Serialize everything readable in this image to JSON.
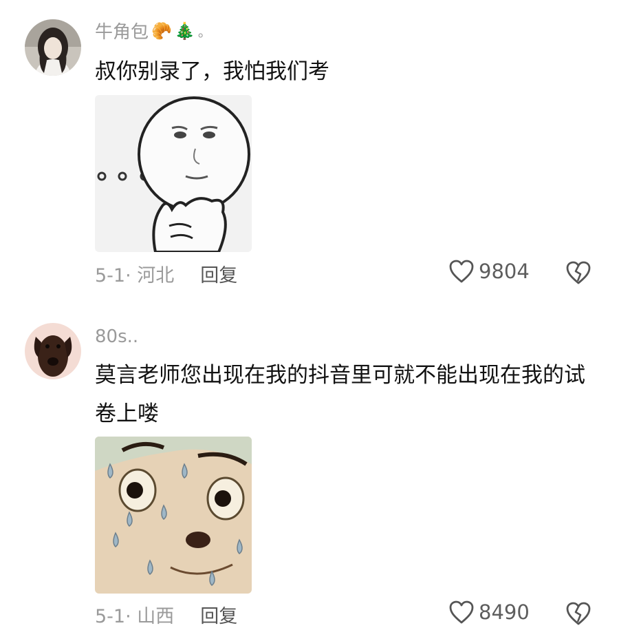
{
  "comments": [
    {
      "username": "牛角包",
      "username_emojis": [
        "🥐",
        "🎄",
        "。"
      ],
      "text": "叔你别录了，我怕我们考",
      "sticker": "thinking-face-sticker",
      "date_location": "5-1· 河北",
      "reply_label": "回复",
      "likes": "9804"
    },
    {
      "username": "80s..",
      "text": "莫言老师您出现在我的抖音里可就不能出现在我的试卷上喽",
      "sticker": "sweating-face-sticker",
      "date_location": "5-1· 山西",
      "reply_label": "回复",
      "likes": "8490"
    }
  ],
  "icons": {
    "like": "heart-outline-icon",
    "dislike": "broken-heart-icon"
  },
  "colors": {
    "username": "#9a9a9a",
    "text": "#121212",
    "meta": "#9a9a9a",
    "background": "#ffffff"
  }
}
